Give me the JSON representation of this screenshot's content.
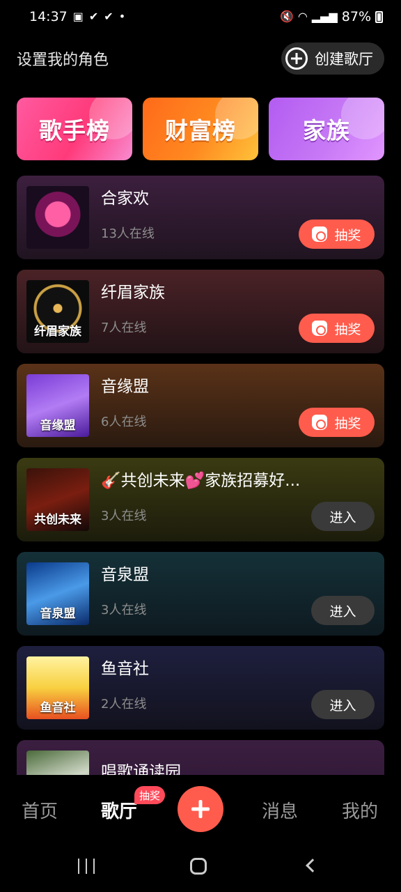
{
  "status_bar": {
    "time": "14:37",
    "left_icons": [
      "gallery-icon",
      "check-icon",
      "check-icon",
      "dot-icon"
    ],
    "battery": "87%"
  },
  "header": {
    "role_link": "设置我的角色",
    "create_button": "创建歌厅"
  },
  "banners": [
    {
      "label": "歌手榜",
      "color": "#ff3a7a"
    },
    {
      "label": "财富榜",
      "color": "#ff8a20"
    },
    {
      "label": "家族",
      "color": "#c678f5"
    }
  ],
  "rooms": [
    {
      "name": "合家欢",
      "online": "13人在线",
      "action": "抽奖",
      "thumb_text": ""
    },
    {
      "name": "纤眉家族",
      "online": "7人在线",
      "action": "抽奖",
      "thumb_text": "纤眉家族"
    },
    {
      "name": "音缘盟",
      "online": "6人在线",
      "action": "抽奖",
      "thumb_text": "音缘盟"
    },
    {
      "name": "🎸共创未来💕家族招募好...",
      "online": "3人在线",
      "action": "进入",
      "thumb_text": "共创未来"
    },
    {
      "name": "音泉盟",
      "online": "3人在线",
      "action": "进入",
      "thumb_text": "音泉盟"
    },
    {
      "name": "鱼音社",
      "online": "2人在线",
      "action": "进入",
      "thumb_text": "鱼音社"
    },
    {
      "name": "唱歌诵读园",
      "online": "",
      "action": "",
      "thumb_text": ""
    }
  ],
  "bottom_nav": {
    "home": "首页",
    "hall": "歌厅",
    "hall_badge": "抽奖",
    "messages": "消息",
    "me": "我的"
  },
  "colors": {
    "accent": "#ff5c4d",
    "badge": "#ff4a5a"
  }
}
